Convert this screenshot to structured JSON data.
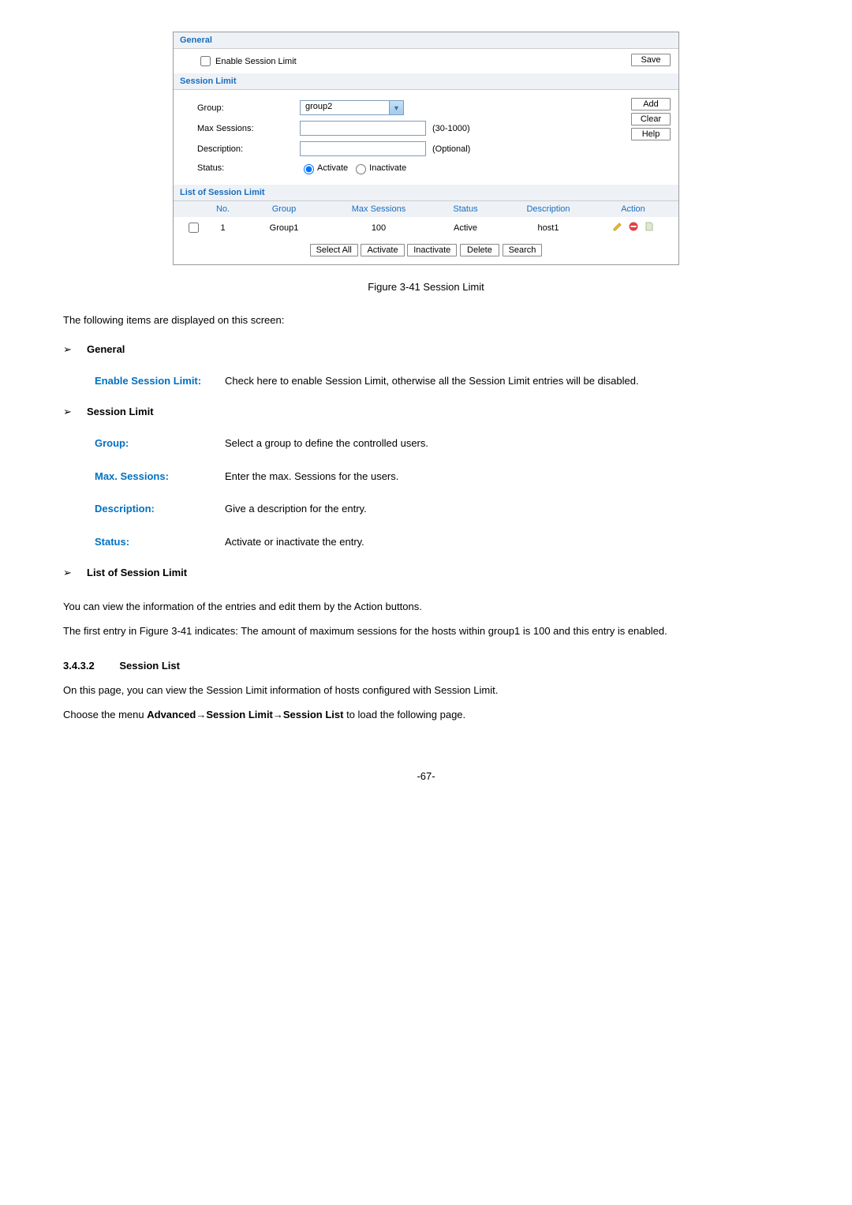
{
  "panel": {
    "general_hdr": "General",
    "enable_session_limit": "Enable Session Limit",
    "save": "Save",
    "session_limit_hdr": "Session Limit",
    "group_label": "Group:",
    "group_value": "group2",
    "max_sessions_label": "Max Sessions:",
    "max_hint": "(30-1000)",
    "description_label": "Description:",
    "desc_hint": "(Optional)",
    "status_label": "Status:",
    "activate": "Activate",
    "inactivate": "Inactivate",
    "add": "Add",
    "clear": "Clear",
    "help": "Help",
    "list_hdr": "List of Session Limit",
    "cols": {
      "no": "No.",
      "group": "Group",
      "max": "Max Sessions",
      "status": "Status",
      "desc": "Description",
      "action": "Action"
    },
    "row": {
      "no": "1",
      "group": "Group1",
      "max": "100",
      "status": "Active",
      "desc": "host1"
    },
    "buttons": {
      "select_all": "Select All",
      "activate": "Activate",
      "inactivate": "Inactivate",
      "delete": "Delete",
      "search": "Search"
    }
  },
  "caption": "Figure 3-41 Session Limit",
  "intro": "The following items are displayed on this screen:",
  "sections": {
    "general": {
      "title": "General",
      "enable_term": "Enable Session Limit:",
      "enable_def": "Check here to enable Session Limit, otherwise all the Session Limit entries will be disabled."
    },
    "session_limit": {
      "title": "Session Limit",
      "group_term": "Group:",
      "group_def": "Select a group to define the controlled users.",
      "max_term": "Max. Sessions:",
      "max_def": "Enter the max. Sessions for the users.",
      "desc_term": "Description:",
      "desc_def": "Give a description for the entry.",
      "status_term": "Status:",
      "status_def": "Activate or inactivate the entry."
    },
    "list": {
      "title": "List of Session Limit",
      "para1": "You can view the information of the entries and edit them by the Action buttons.",
      "para2": "The first entry in Figure 3-41 indicates: The amount of maximum sessions for the hosts within group1 is 100 and this entry is enabled."
    }
  },
  "heading": {
    "num": "3.4.3.2",
    "title": "Session List",
    "para1": "On this page, you can view the Session Limit information of hosts configured with Session Limit.",
    "para2_a": "Choose the menu ",
    "para2_b": "Advanced→Session Limit→Session List",
    "para2_c": " to load the following page."
  },
  "page": "-67-"
}
